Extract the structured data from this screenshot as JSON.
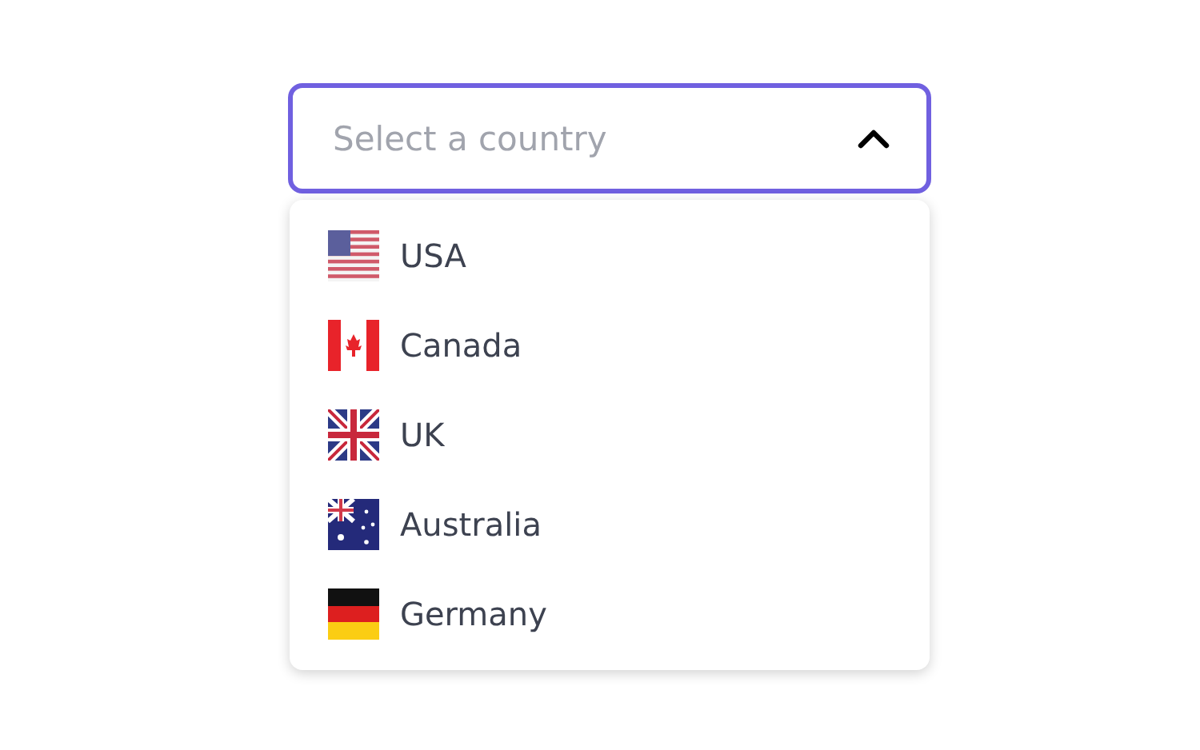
{
  "select": {
    "placeholder": "Select a country",
    "expanded": true
  },
  "options": [
    {
      "label": "USA",
      "kind": "usa"
    },
    {
      "label": "Canada",
      "kind": "canada"
    },
    {
      "label": "UK",
      "kind": "uk"
    },
    {
      "label": "Australia",
      "kind": "australia"
    },
    {
      "label": "Germany",
      "kind": "germany"
    }
  ]
}
